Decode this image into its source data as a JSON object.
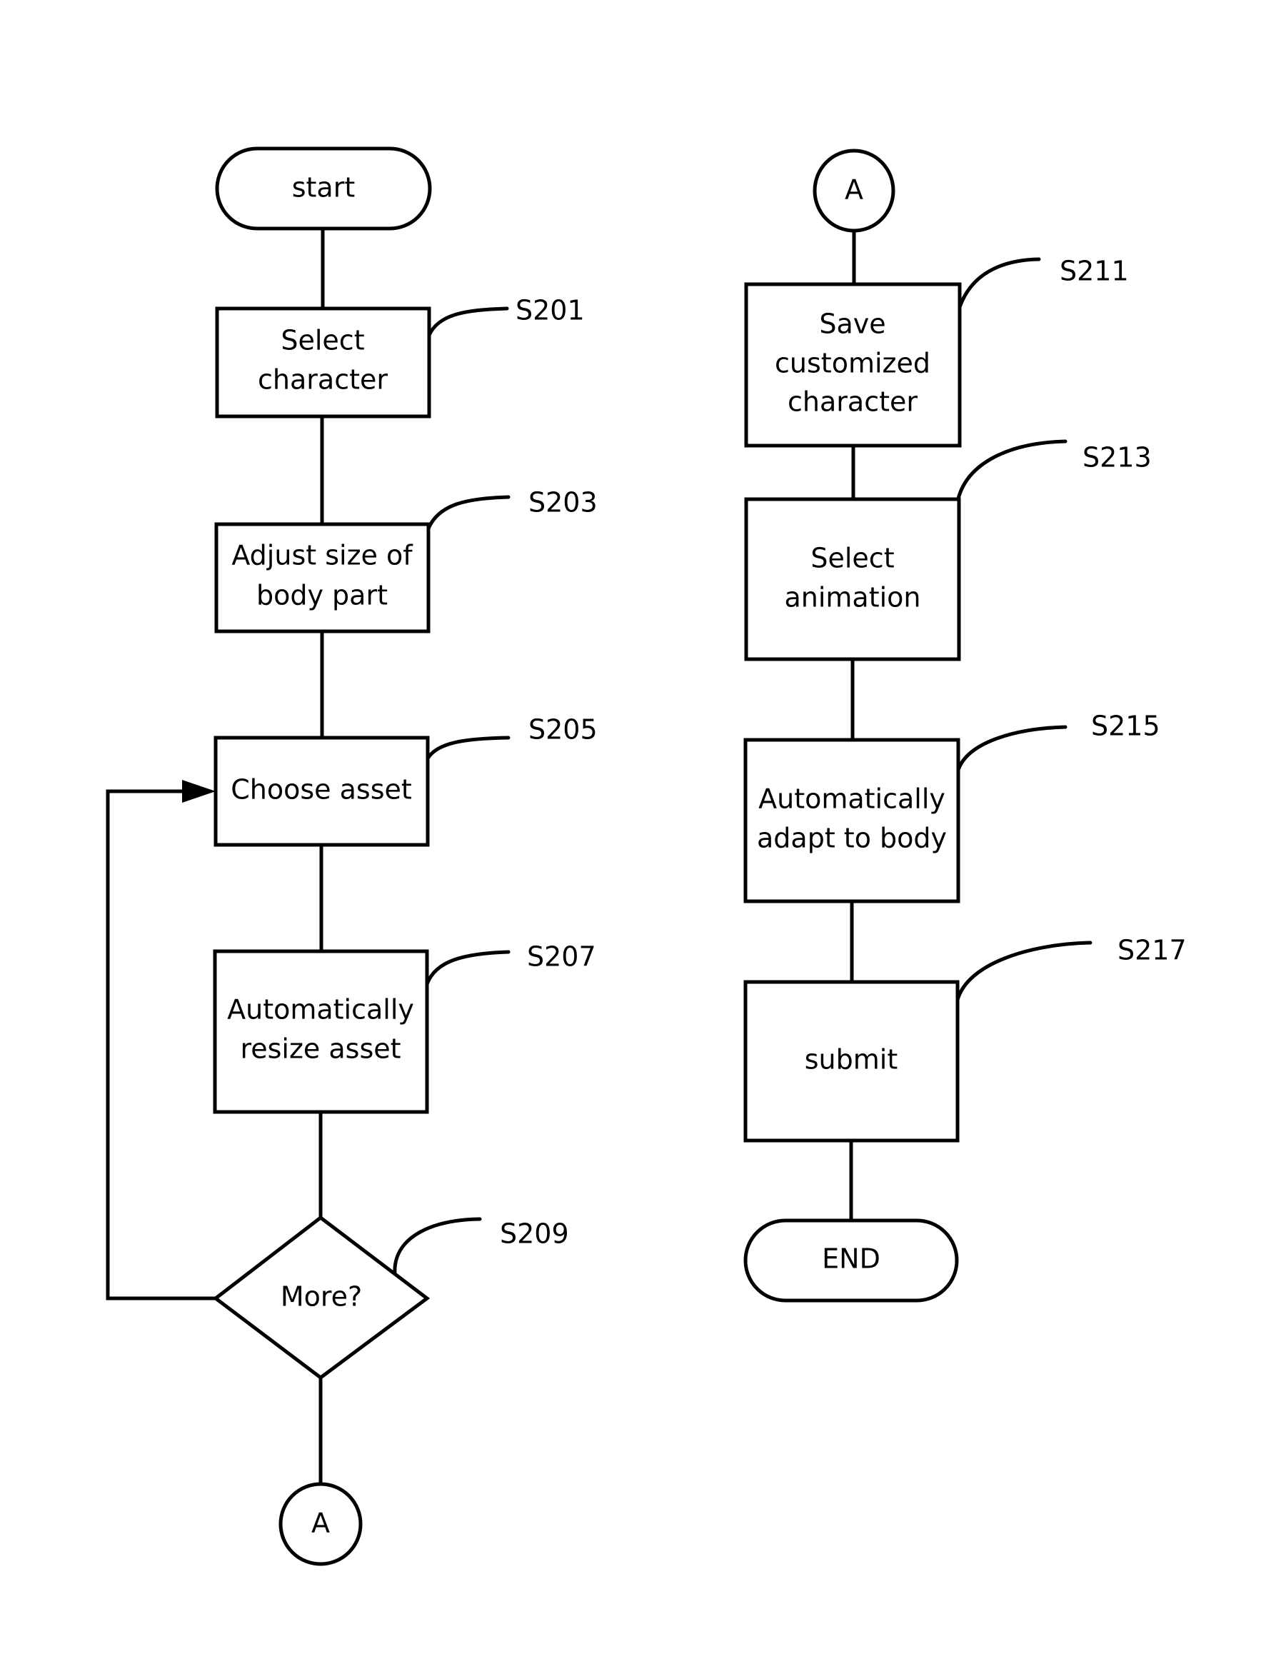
{
  "diagram": {
    "type": "flowchart",
    "colors": {
      "stroke": "#000000",
      "background": "#ffffff"
    },
    "nodes": {
      "start": {
        "label": "start",
        "shape": "terminal"
      },
      "s201": {
        "label_lines": [
          "Select",
          "character"
        ],
        "ref": "S201",
        "shape": "process"
      },
      "s203": {
        "label_lines": [
          "Adjust size of",
          "body part"
        ],
        "ref": "S203",
        "shape": "process"
      },
      "s205": {
        "label_lines": [
          "Choose asset"
        ],
        "ref": "S205",
        "shape": "process"
      },
      "s207": {
        "label_lines": [
          "Automatically",
          "resize asset"
        ],
        "ref": "S207",
        "shape": "process"
      },
      "s209": {
        "label": "More?",
        "ref": "S209",
        "shape": "decision"
      },
      "connector_out": {
        "label": "A",
        "shape": "connector"
      },
      "connector_in": {
        "label": "A",
        "shape": "connector"
      },
      "s211": {
        "label_lines": [
          "Save",
          "customized",
          "character"
        ],
        "ref": "S211",
        "shape": "process"
      },
      "s213": {
        "label_lines": [
          "Select",
          "animation"
        ],
        "ref": "S213",
        "shape": "process"
      },
      "s215": {
        "label_lines": [
          "Automatically",
          "adapt to body"
        ],
        "ref": "S215",
        "shape": "process"
      },
      "s217": {
        "label_lines": [
          "submit"
        ],
        "ref": "S217",
        "shape": "process"
      },
      "end": {
        "label": "END",
        "shape": "terminal"
      }
    },
    "edges": [
      {
        "from": "start",
        "to": "s201"
      },
      {
        "from": "s201",
        "to": "s203"
      },
      {
        "from": "s203",
        "to": "s205"
      },
      {
        "from": "s205",
        "to": "s207"
      },
      {
        "from": "s207",
        "to": "s209"
      },
      {
        "from": "s209",
        "to": "s205",
        "note": "loop back (more)",
        "arrow": true
      },
      {
        "from": "s209",
        "to": "connector_out"
      },
      {
        "from": "connector_in",
        "to": "s211"
      },
      {
        "from": "s211",
        "to": "s213"
      },
      {
        "from": "s213",
        "to": "s215"
      },
      {
        "from": "s215",
        "to": "s217"
      },
      {
        "from": "s217",
        "to": "end"
      }
    ]
  }
}
